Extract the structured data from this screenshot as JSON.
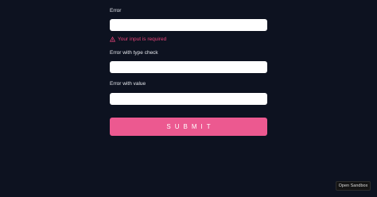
{
  "form": {
    "fields": [
      {
        "label": "Error",
        "value": ""
      },
      {
        "label": "Error with type check",
        "value": ""
      },
      {
        "label": "Error with value",
        "value": ""
      }
    ],
    "error_message": "Your input is required",
    "submit_label": "SUBMIT"
  },
  "sandbox": {
    "button_label": "Open Sandbox"
  },
  "colors": {
    "background": "#0d1220",
    "accent": "#ec5990",
    "error": "#e8447a"
  },
  "icons": {
    "error": "warning-triangle-icon"
  }
}
